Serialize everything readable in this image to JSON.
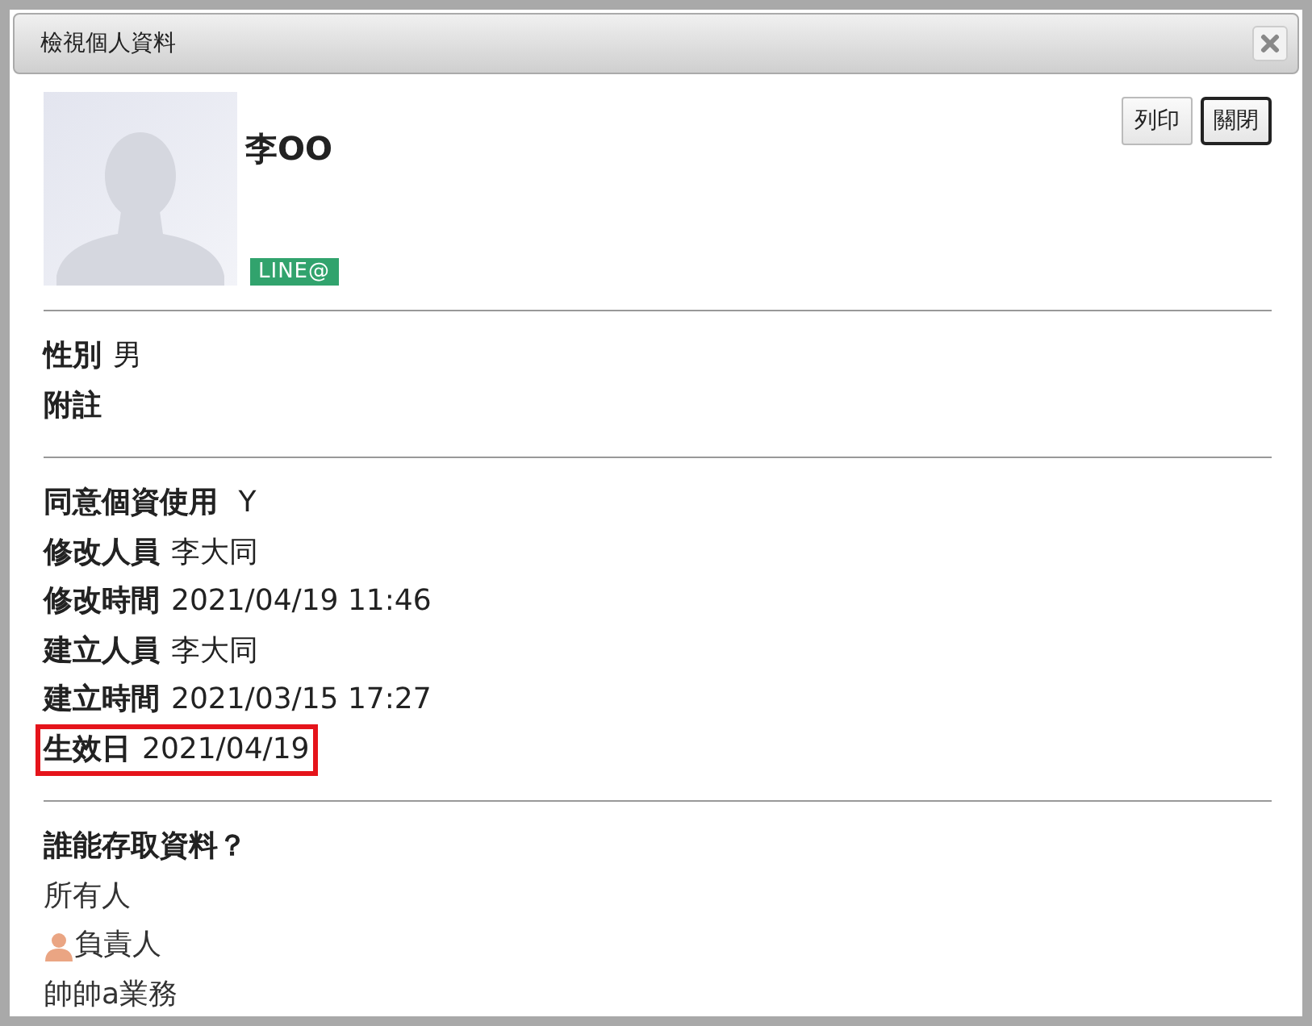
{
  "dialog": {
    "title": "檢視個人資料"
  },
  "profile": {
    "name": "李OO",
    "tag": "LINE@"
  },
  "buttons": [
    {
      "label": "列印",
      "focused": false
    },
    {
      "label": "關閉",
      "focused": true
    }
  ],
  "sections": [
    [
      {
        "label": "性別",
        "value": "男",
        "highlighted": false
      },
      {
        "label": "附註",
        "highlighted": false
      }
    ],
    [
      {
        "label": "同意個資使用",
        "value": " Y",
        "highlighted": false
      },
      {
        "label": "修改人員",
        "value": "李大同",
        "highlighted": false
      },
      {
        "label": "修改時間",
        "value": "2021/04/19 11:46",
        "highlighted": false
      },
      {
        "label": "建立人員",
        "value": "李大同",
        "highlighted": false
      },
      {
        "label": "建立時間",
        "value": "2021/03/15 17:27",
        "highlighted": false
      },
      {
        "label": "生效日",
        "value": "2021/04/19",
        "highlighted": true
      }
    ]
  ],
  "access": {
    "heading": "誰能存取資料？",
    "items": [
      {
        "kind": "plain",
        "text": "所有人"
      },
      {
        "kind": "person",
        "text": "負責人"
      },
      {
        "kind": "plain",
        "text": "帥帥a業務"
      }
    ]
  }
}
